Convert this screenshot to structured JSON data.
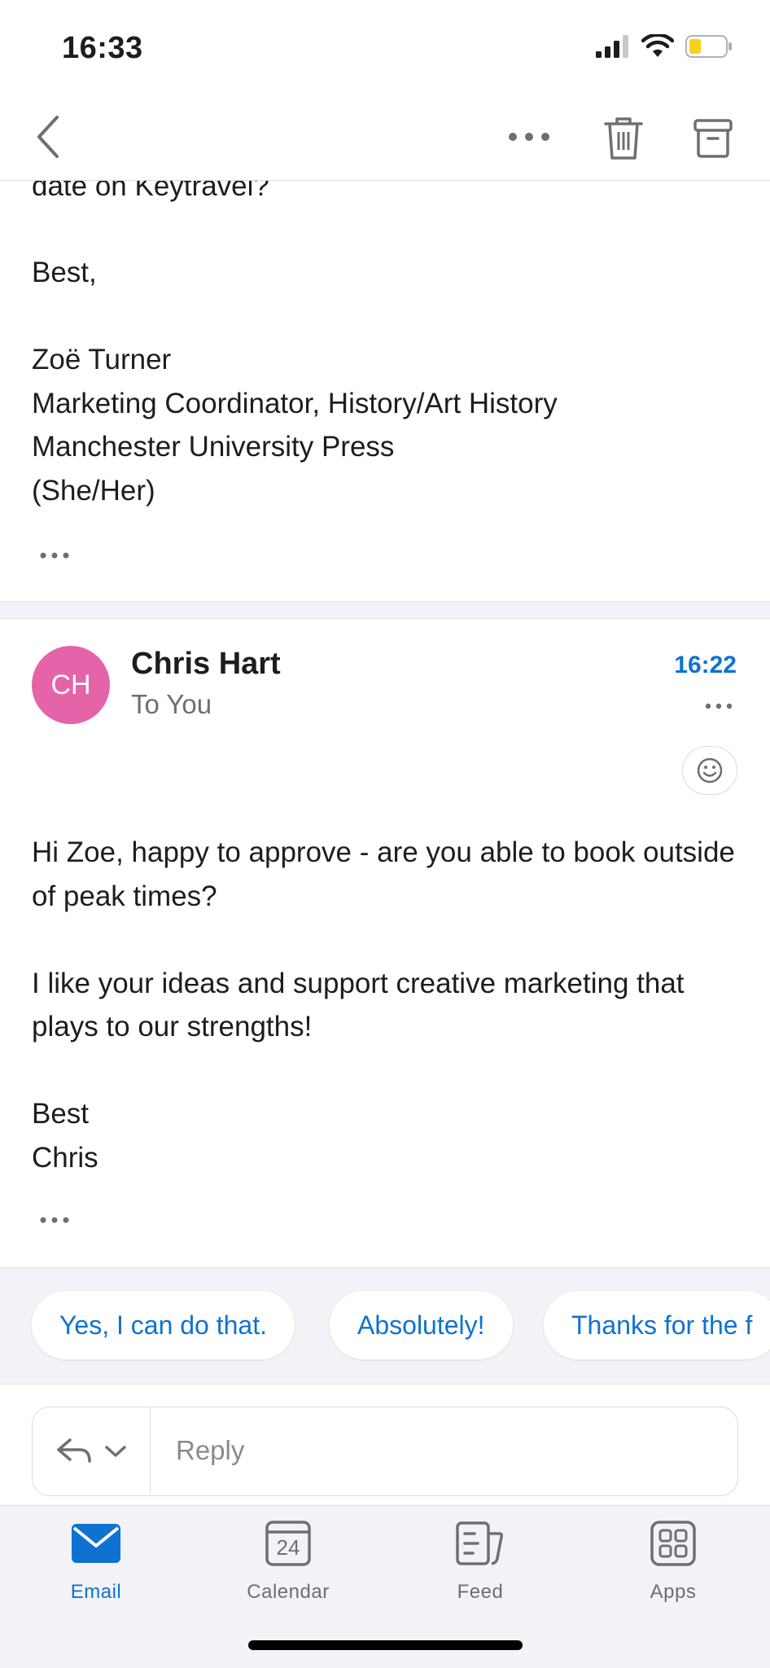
{
  "status_bar": {
    "time": "16:33",
    "icons": [
      "signal-icon",
      "wifi-icon",
      "battery-icon"
    ]
  },
  "toolbar": {
    "icons": [
      "back-chevron-icon",
      "more-horizontal-icon",
      "trash-icon",
      "archive-icon"
    ]
  },
  "previous_message": {
    "cut_line": "date on Keytravel?",
    "lines": [
      "Best,",
      "",
      "Zoë Turner",
      "Marketing Coordinator, History/Art History",
      "Manchester University Press",
      "(She/Her)"
    ]
  },
  "message": {
    "avatar_initials": "CH",
    "avatar_color": "#e563a9",
    "sender": "Chris Hart",
    "recipient": "To You",
    "time": "16:22",
    "body": [
      "Hi Zoe, happy to approve - are you able to book outside of peak times?",
      "",
      "I like your ideas and support creative marketing that plays to our strengths!",
      "",
      "Best",
      "Chris"
    ]
  },
  "suggested_replies": [
    "Yes, I can do that.",
    "Absolutely!",
    "Thanks for the f"
  ],
  "reply": {
    "placeholder": "Reply"
  },
  "tabs": [
    {
      "label": "Email",
      "icon": "mail-icon",
      "active": true
    },
    {
      "label": "Calendar",
      "icon": "calendar-icon",
      "active": false,
      "day": "24"
    },
    {
      "label": "Feed",
      "icon": "feed-icon",
      "active": false
    },
    {
      "label": "Apps",
      "icon": "apps-icon",
      "active": false
    }
  ],
  "colors": {
    "accent": "#0f72d0",
    "avatar": "#e563a9",
    "battery": "#f7d21c",
    "background_gray": "#f2f2f7"
  }
}
